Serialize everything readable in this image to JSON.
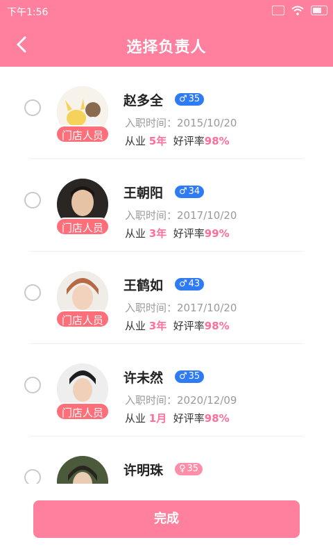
{
  "status_bar": {
    "time": "下午1:56"
  },
  "header": {
    "title": "选择负责人"
  },
  "employees": [
    {
      "name": "赵多全",
      "gender": "male",
      "gender_symbol": "♂",
      "age": "35",
      "role": "门店人员",
      "hire_label": "入职时间：",
      "hire_date": "2015/10/20",
      "exp_prefix": "从业 ",
      "years": "5年",
      "rating_label": "好评率",
      "rating": "98%"
    },
    {
      "name": "王朝阳",
      "gender": "male",
      "gender_symbol": "♂",
      "age": "34",
      "role": "门店人员",
      "hire_label": "入职时间：",
      "hire_date": "2017/10/20",
      "exp_prefix": "从业 ",
      "years": "3年",
      "rating_label": "好评率",
      "rating": "99%"
    },
    {
      "name": "王鹤如",
      "gender": "male",
      "gender_symbol": "♂",
      "age": "43",
      "role": "门店人员",
      "hire_label": "入职时间：",
      "hire_date": "2017/10/20",
      "exp_prefix": "从业 ",
      "years": "3年",
      "rating_label": "好评率",
      "rating": "98%"
    },
    {
      "name": "许未然",
      "gender": "male",
      "gender_symbol": "♂",
      "age": "35",
      "role": "门店人员",
      "hire_label": "入职时间：",
      "hire_date": "2020/12/09",
      "exp_prefix": "从业 ",
      "years": "1月",
      "rating_label": "好评率",
      "rating": "98%"
    },
    {
      "name": "许明珠",
      "gender": "female",
      "gender_symbol": "♀",
      "age": "35"
    }
  ],
  "footer": {
    "done_label": "完成"
  },
  "colors": {
    "brand": "#ff7f9f",
    "male": "#2f7bf5",
    "female": "#ff8fa8",
    "role_badge": "#ff6f7a",
    "highlight": "#ff6f9a"
  }
}
